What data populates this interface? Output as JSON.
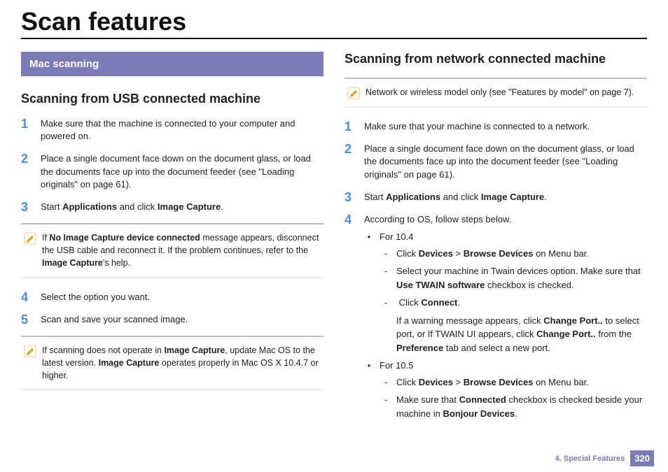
{
  "title": "Scan features",
  "left": {
    "banner": "Mac scanning",
    "subheading": "Scanning from USB connected machine",
    "steps": {
      "s1": {
        "n": "1",
        "t": "Make sure that the machine is connected to your computer and powered on."
      },
      "s2": {
        "n": "2",
        "t": "Place a single document face down on the document glass, or load the documents face up into the document feeder (see \"Loading originals\" on page 61)."
      },
      "s3": {
        "n": "3"
      },
      "s4": {
        "n": "4",
        "t": "Select the option you want."
      },
      "s5": {
        "n": "5",
        "t": "Scan and save your scanned image."
      }
    }
  },
  "right": {
    "subheading": "Scanning from network connected machine",
    "note1": "Network or wireless model only (see \"Features by model\" on page 7).",
    "steps": {
      "s1": {
        "n": "1",
        "t": "Make sure that your machine is connected to a network."
      },
      "s2": {
        "n": "2",
        "t": "Place a single document face down on the document glass, or load the documents face up into the document feeder (see \"Loading originals\" on page 61)."
      },
      "s3": {
        "n": "3"
      },
      "s4": {
        "n": "4",
        "t": "According to OS, follow steps below."
      }
    },
    "os104": "For 10.4",
    "os105": "For 10.5"
  },
  "footer": {
    "chapter": "4.  Special Features",
    "page": "320"
  }
}
